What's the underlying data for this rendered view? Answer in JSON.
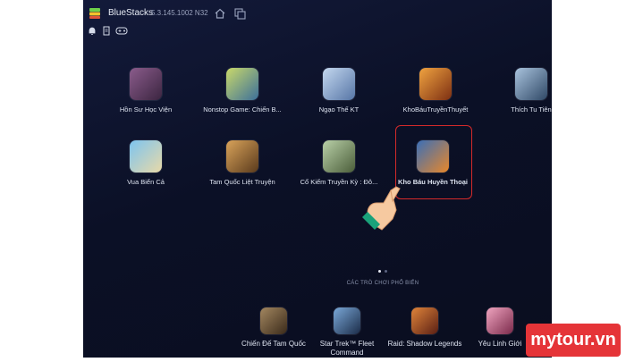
{
  "window": {
    "app_name": "BlueStacks",
    "version": "5.3.145.1002 N32",
    "icons": [
      "bluestacks-logo-icon",
      "home-icon",
      "multi-instance-icon",
      "bell-icon",
      "clipboard-icon",
      "gamepad-icon"
    ]
  },
  "apps_row1": [
    {
      "label": "Hồn Sư Học Viện",
      "icon": "honsu-app-icon",
      "color": "#5b3a66"
    },
    {
      "label": "Nonstop Game: Chiến B...",
      "icon": "nonstop-app-icon",
      "color": "#3c6f9a"
    },
    {
      "label": "Ngạo Thế KT",
      "icon": "ngaothe-app-icon",
      "color": "#7aa0c8"
    },
    {
      "label": "KhoBáuTruyềnThuyết",
      "icon": "khobau-app-icon",
      "color": "#c9691f"
    },
    {
      "label": "Thích Tu Tiên",
      "icon": "thichtutien-app-icon",
      "color": "#4a6a8a"
    }
  ],
  "apps_row2": [
    {
      "label": "Vua Biển Cả",
      "icon": "vuabienca-app-icon",
      "color": "#3b8fd1"
    },
    {
      "label": "Tam Quốc Liệt Truyện",
      "icon": "tamquoc-app-icon",
      "color": "#a3652c"
    },
    {
      "label": "Cổ Kiếm Truyền Kỳ : Đô...",
      "icon": "cokiem-app-icon",
      "color": "#6c8a5a"
    },
    {
      "label": "Kho Báu Huyền Thoại",
      "icon": "khobauhuyenthoai-app-icon",
      "color": "#c85a18"
    }
  ],
  "popular": {
    "label": "CÁC TRÒ CHƠI PHỔ BIẾN",
    "page_dots": [
      "active",
      "inactive"
    ]
  },
  "popular_apps": [
    {
      "label": "Chiến Đế Tam Quốc",
      "icon": "chiende-app-icon",
      "color": "#6b5238"
    },
    {
      "label": "Star Trek™ Fleet Command",
      "label1": "Star Trek™ Fleet",
      "label2": "Command",
      "icon": "startrek-app-icon",
      "color": "#2d4c7a"
    },
    {
      "label": "Raid: Shadow Legends",
      "icon": "raid-app-icon",
      "color": "#8a3a22"
    },
    {
      "label": "Yêu Linh Giới",
      "icon": "yeulinh-app-icon",
      "color": "#b2476e"
    }
  ],
  "watermark": {
    "text": "mytour.vn",
    "color": "#e53438"
  },
  "pointer": {
    "icon": "pointing-hand-icon"
  }
}
